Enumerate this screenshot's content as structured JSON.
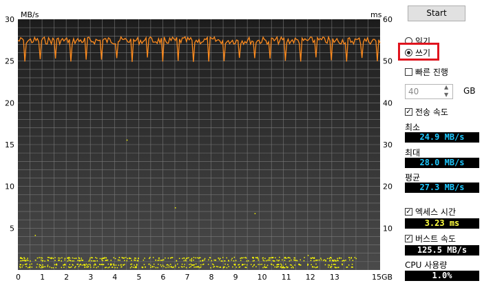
{
  "buttons": {
    "start": "Start"
  },
  "mode": {
    "read_label": "읽기",
    "write_label": "쓰기",
    "selected": "write"
  },
  "options": {
    "fast_progress_label": "빠른 진행",
    "size_value": "40",
    "size_unit": "GB",
    "transfer_speed_label": "전송 속도",
    "access_time_label": "엑세스 시간",
    "burst_speed_label": "버스트 속도"
  },
  "stats": {
    "min_label": "최소",
    "min_value": "24.9 MB/s",
    "max_label": "최대",
    "max_value": "28.0 MB/s",
    "avg_label": "평균",
    "avg_value": "27.3 MB/s",
    "access_value": "3.23 ms",
    "burst_value": "125.5 MB/s",
    "cpu_label": "CPU 사용량",
    "cpu_value": "1.0%"
  },
  "colors": {
    "speed_line": "#ff8c1e",
    "access_points": "#ffff00",
    "value_text": "#1ec8ff"
  },
  "chart_data": {
    "type": "line",
    "left_unit": "MB/s",
    "right_unit": "ms",
    "x_ticks": [
      "0",
      "1",
      "2",
      "3",
      "4",
      "5",
      "6",
      "7",
      "8",
      "9",
      "10",
      "11",
      "12",
      "13",
      "15GB"
    ],
    "y_left_ticks": [
      "30",
      "25",
      "20",
      "15",
      "10",
      "5"
    ],
    "y_right_ticks": [
      "60",
      "50",
      "40",
      "30",
      "20",
      "10"
    ],
    "xlim": [
      0,
      15
    ],
    "ylim_left": [
      0,
      30
    ],
    "ylim_right": [
      0,
      60
    ],
    "grid": true,
    "series": [
      {
        "values_summary_min": 24.9,
        "values_summary_max": 28.0,
        "values_summary_avg": 27.3
      }
    ],
    "access_time_avg_ms": 3.23
  }
}
